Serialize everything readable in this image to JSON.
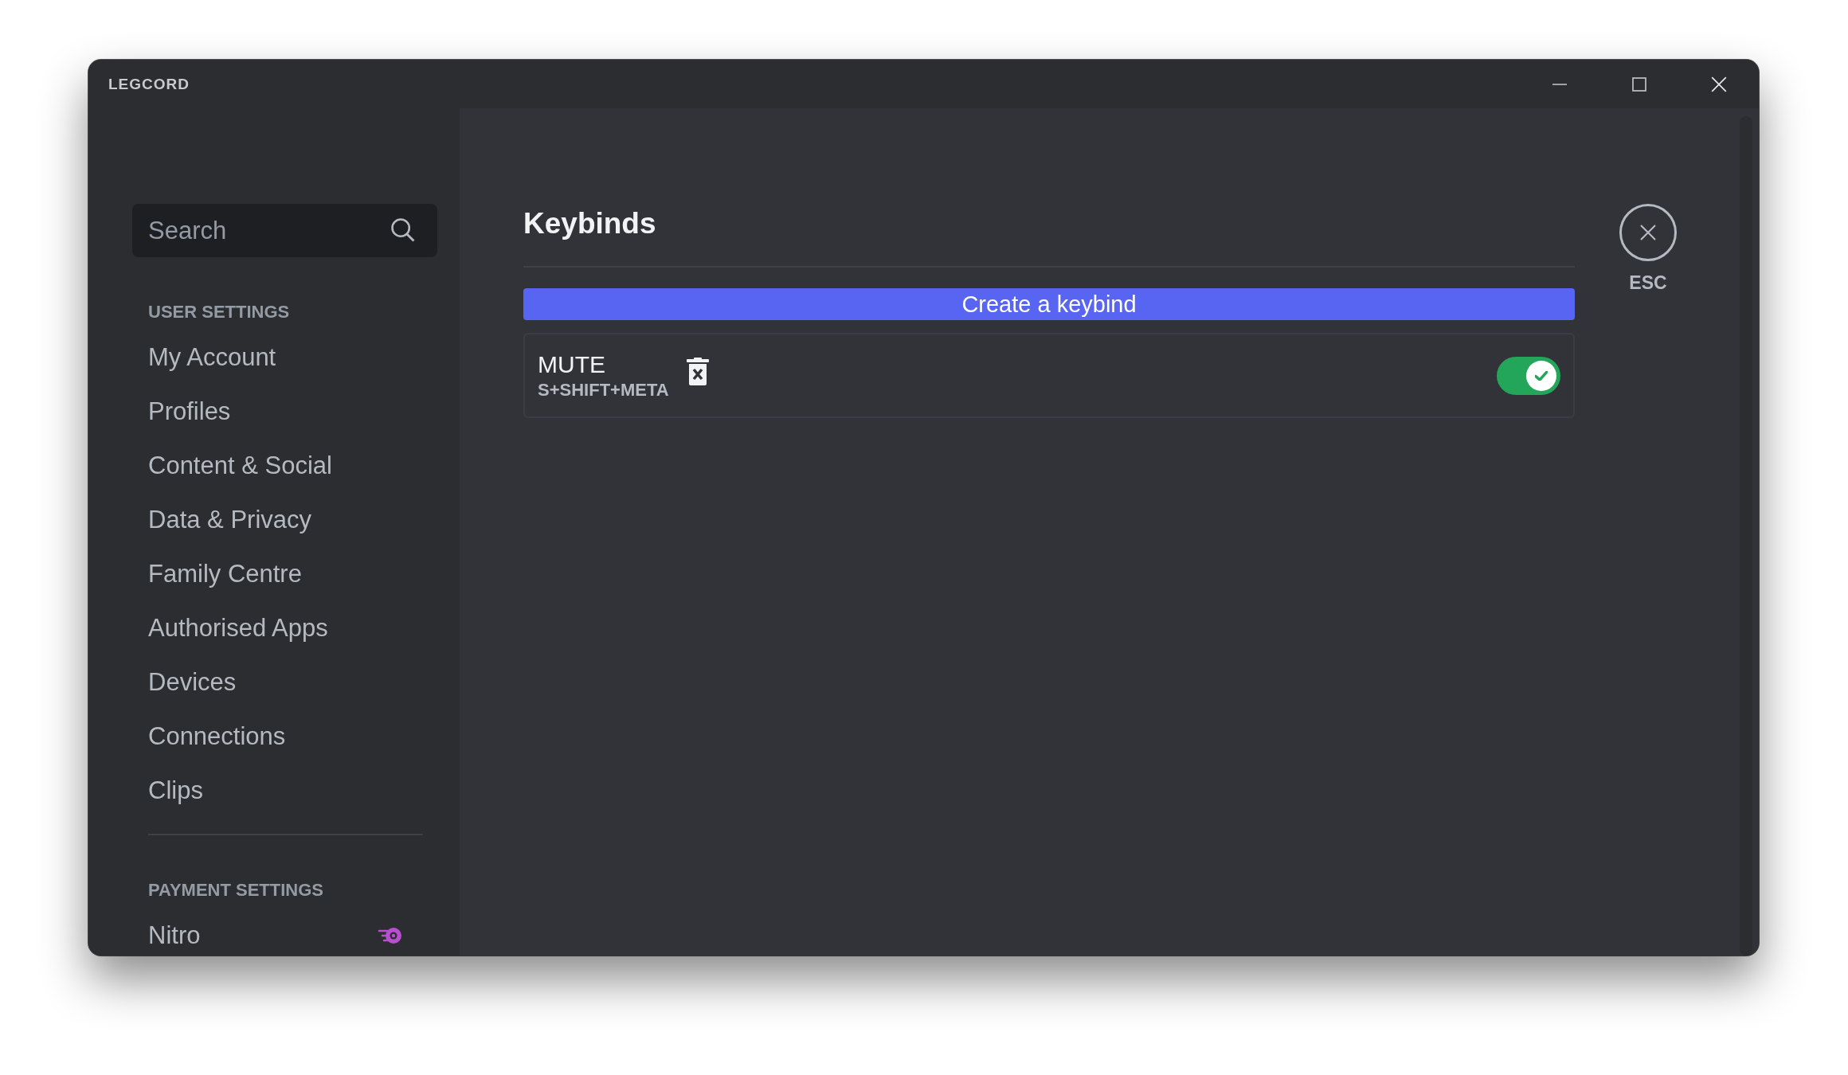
{
  "window": {
    "title": "LEGCORD"
  },
  "sidebar": {
    "search": {
      "placeholder": "Search"
    },
    "sections": [
      {
        "heading": "USER SETTINGS",
        "items": [
          {
            "label": "My Account",
            "kind": "plain",
            "selected": false
          },
          {
            "label": "Profiles",
            "kind": "plain",
            "selected": false
          },
          {
            "label": "Content & Social",
            "kind": "plain",
            "selected": false
          },
          {
            "label": "Data & Privacy",
            "kind": "plain",
            "selected": false
          },
          {
            "label": "Family Centre",
            "kind": "plain",
            "selected": false
          },
          {
            "label": "Authorised Apps",
            "kind": "plain",
            "selected": false
          },
          {
            "label": "Devices",
            "kind": "plain",
            "selected": false
          },
          {
            "label": "Connections",
            "kind": "plain",
            "selected": false
          },
          {
            "label": "Clips",
            "kind": "plain",
            "selected": false
          }
        ]
      },
      {
        "heading": "PAYMENT SETTINGS",
        "items": [
          {
            "label": "Nitro",
            "kind": "premium",
            "selected": false
          }
        ]
      }
    ]
  },
  "content": {
    "title": "Keybinds",
    "create_button": "Create a keybind",
    "keybinds": [
      {
        "name": "MUTE",
        "keys": "S+SHIFT+META",
        "enabled": true
      }
    ]
  },
  "close": {
    "label": "ESC"
  }
}
